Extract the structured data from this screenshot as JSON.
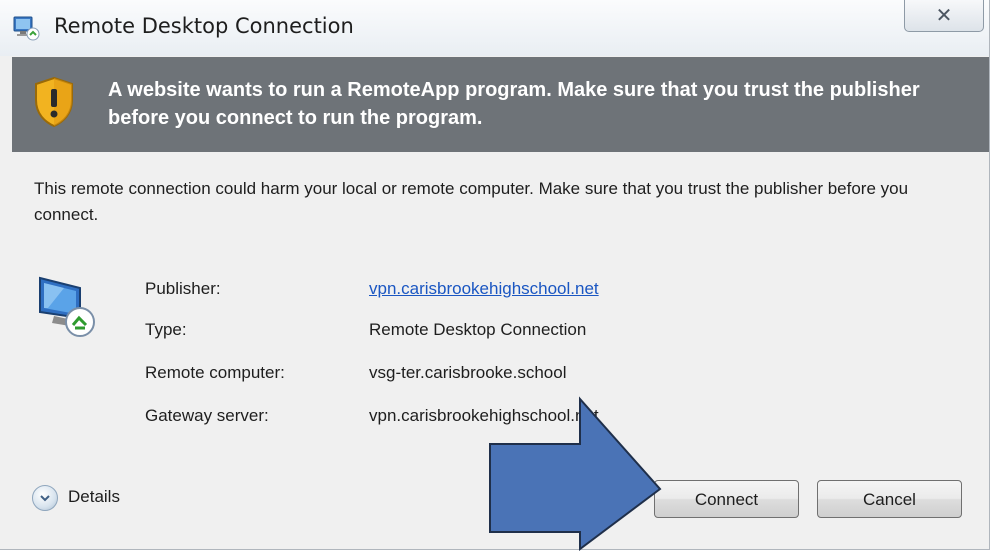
{
  "window": {
    "title": "Remote Desktop Connection",
    "close_glyph": "✕",
    "icons": {
      "title": "remote-desktop-icon",
      "close": "close-icon"
    }
  },
  "banner": {
    "icon": "shield-warning-icon",
    "text": "A website wants to run a RemoteApp program. Make sure that you trust the publisher before you connect to run the program."
  },
  "intro": "This remote connection could harm your local or remote computer. Make sure that you trust the publisher before you connect.",
  "details_icon": "computer-icon",
  "info": [
    {
      "label": "Publisher:",
      "value": "vpn.carisbrookehighschool.net",
      "is_link": true
    },
    {
      "label": "Type:",
      "value": "Remote Desktop Connection",
      "is_link": false
    },
    {
      "label": "Remote computer:",
      "value": "vsg-ter.carisbrooke.school",
      "is_link": false
    },
    {
      "label": "Gateway server:",
      "value": "vpn.carisbrookehighschool.net",
      "is_link": false
    }
  ],
  "footer": {
    "details_label": "Details",
    "details_icon": "chevron-down-circle-icon",
    "connect_label": "Connect",
    "cancel_label": "Cancel"
  },
  "annotation": {
    "type": "arrow",
    "points_to": "connect",
    "color": "#4a73b6",
    "border_color": "#1f2f4a"
  },
  "colors": {
    "banner_bg": "#6e7378",
    "link": "#1a56c2",
    "dialog_bg": "#f0f0f0"
  }
}
